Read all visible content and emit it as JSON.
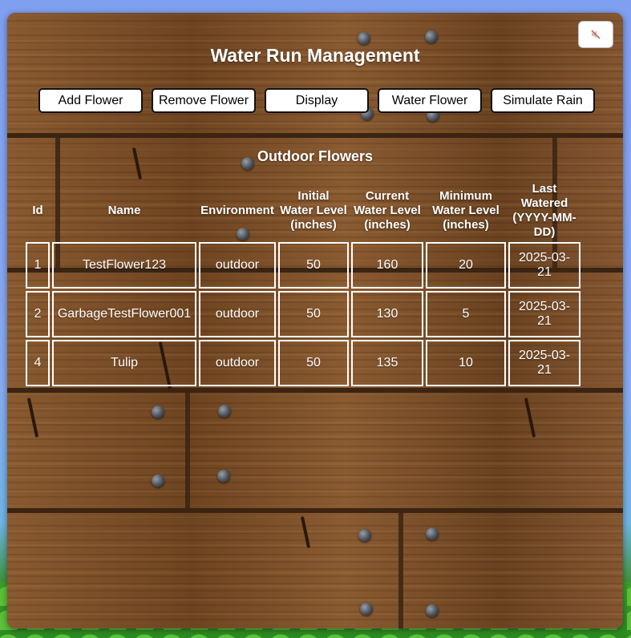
{
  "page": {
    "title": "Water Run Management",
    "mute_icon": "speaker-muted-icon"
  },
  "toolbar": {
    "add_label": "Add Flower",
    "remove_label": "Remove Flower",
    "display_label": "Display",
    "water_label": "Water Flower",
    "rain_label": "Simulate Rain"
  },
  "table": {
    "title": "Outdoor Flowers",
    "headers": {
      "id": "Id",
      "name": "Name",
      "environment": "Environment",
      "initial": "Initial Water Level (inches)",
      "current": "Current Water Level (inches)",
      "minimum": "Minimum Water Level (inches)",
      "watered": "Last Watered (YYYY-MM-DD)"
    },
    "rows": [
      {
        "id": "1",
        "name": "TestFlower123",
        "environment": "outdoor",
        "initial": "50",
        "current": "160",
        "minimum": "20",
        "watered": "2025-03-21"
      },
      {
        "id": "2",
        "name": "GarbageTestFlower001",
        "environment": "outdoor",
        "initial": "50",
        "current": "130",
        "minimum": "5",
        "watered": "2025-03-21"
      },
      {
        "id": "4",
        "name": "Tulip",
        "environment": "outdoor",
        "initial": "50",
        "current": "135",
        "minimum": "10",
        "watered": "2025-03-21"
      }
    ]
  }
}
